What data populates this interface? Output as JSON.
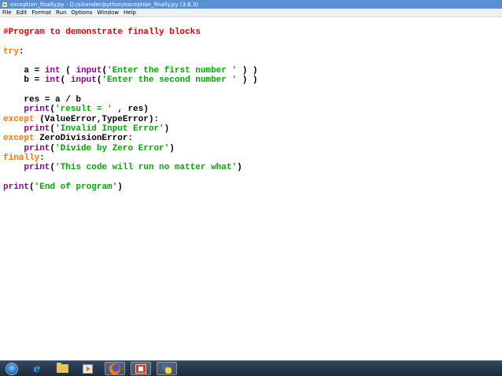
{
  "window": {
    "title": "exception_finally.py - D:/sikander/python/exception_finally.py (3.6.3)"
  },
  "menu": {
    "items": [
      "File",
      "Edit",
      "Format",
      "Run",
      "Options",
      "Window",
      "Help"
    ]
  },
  "editor": {
    "lines": [
      [
        {
          "t": "#Program to demonstrate finally blocks",
          "c": "cm"
        }
      ],
      [],
      [
        {
          "t": "try",
          "c": "kw"
        },
        {
          "t": ":"
        }
      ],
      [],
      [
        {
          "t": "    a = "
        },
        {
          "t": "int",
          "c": "bi"
        },
        {
          "t": " ( "
        },
        {
          "t": "input",
          "c": "bi"
        },
        {
          "t": "("
        },
        {
          "t": "'Enter the first number '",
          "c": "str"
        },
        {
          "t": " ) )"
        }
      ],
      [
        {
          "t": "    b = "
        },
        {
          "t": "int",
          "c": "bi"
        },
        {
          "t": "( "
        },
        {
          "t": "input",
          "c": "bi"
        },
        {
          "t": "("
        },
        {
          "t": "'Enter the second number '",
          "c": "str"
        },
        {
          "t": " ) )"
        }
      ],
      [],
      [
        {
          "t": "    res = a / b"
        }
      ],
      [
        {
          "t": "    "
        },
        {
          "t": "print",
          "c": "bi"
        },
        {
          "t": "("
        },
        {
          "t": "'result = '",
          "c": "str"
        },
        {
          "t": " , res)"
        }
      ],
      [
        {
          "t": "except",
          "c": "kw"
        },
        {
          "t": " (ValueError,TypeError):"
        }
      ],
      [
        {
          "t": "    "
        },
        {
          "t": "print",
          "c": "bi"
        },
        {
          "t": "("
        },
        {
          "t": "'Invalid Input Error'",
          "c": "str"
        },
        {
          "t": ")"
        }
      ],
      [
        {
          "t": "except",
          "c": "kw"
        },
        {
          "t": " ZeroDivisionError:"
        }
      ],
      [
        {
          "t": "    "
        },
        {
          "t": "print",
          "c": "bi"
        },
        {
          "t": "("
        },
        {
          "t": "'Divide by Zero Error'",
          "c": "str"
        },
        {
          "t": ")"
        }
      ],
      [
        {
          "t": "finally",
          "c": "kw"
        },
        {
          "t": ":"
        }
      ],
      [
        {
          "t": "    "
        },
        {
          "t": "print",
          "c": "bi"
        },
        {
          "t": "("
        },
        {
          "t": "'This code will run no matter what'",
          "c": "str"
        },
        {
          "t": ")"
        }
      ],
      [],
      [
        {
          "t": "print",
          "c": "bi"
        },
        {
          "t": "("
        },
        {
          "t": "'End of program'",
          "c": "str"
        },
        {
          "t": ")"
        }
      ]
    ]
  },
  "taskbar": {
    "items": [
      {
        "icon": "start-orb-icon"
      },
      {
        "icon": "internet-explorer-icon"
      },
      {
        "icon": "file-explorer-icon"
      },
      {
        "icon": "media-player-icon"
      },
      {
        "icon": "firefox-icon"
      },
      {
        "icon": "powerpoint-icon"
      },
      {
        "icon": "python-idle-icon"
      }
    ]
  },
  "colors": {
    "keyword": "#ff7700",
    "builtin": "#900090",
    "string": "#00aa00",
    "comment": "#dd0000",
    "titlebar": "#5b8fd4"
  }
}
